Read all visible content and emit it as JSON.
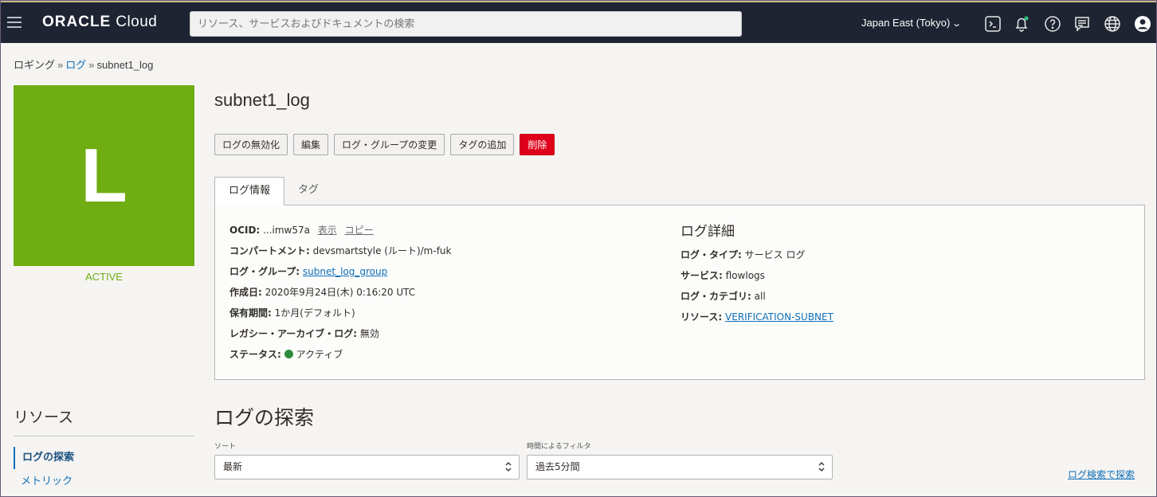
{
  "header": {
    "brand": "ORACLE",
    "product": "Cloud",
    "search_placeholder": "リソース、サービスおよびドキュメントの検索",
    "region": "Japan East (Tokyo)",
    "icons": [
      "menu-icon",
      "cloud-shell-icon",
      "bell-icon",
      "help-icon",
      "chat-icon",
      "globe-icon",
      "user-icon"
    ],
    "colors": {
      "bar": "#1e2432",
      "notification_dot": "#2ec27e"
    }
  },
  "breadcrumb": {
    "items": [
      "ロギング",
      "ログ",
      "subnet1_log"
    ],
    "separator": "»"
  },
  "resource": {
    "letter": "L",
    "status": "ACTIVE",
    "tile_color": "#6fad12"
  },
  "page": {
    "title": "subnet1_log"
  },
  "actions": {
    "disable": "ログの無効化",
    "edit": "編集",
    "change_group": "ログ・グループの変更",
    "add_tags": "タグの追加",
    "delete": "削除"
  },
  "tabs": [
    {
      "label": "ログ情報",
      "active": true
    },
    {
      "label": "タグ",
      "active": false
    }
  ],
  "log_info": {
    "ocid_label": "OCID:",
    "ocid_value": "...imw57a",
    "ocid_show": "表示",
    "ocid_copy": "コピー",
    "compartment_label": "コンパートメント:",
    "compartment_value": "devsmartstyle (ルート)/m-fuk",
    "group_label": "ログ・グループ:",
    "group_value": "subnet_log_group",
    "created_label": "作成日:",
    "created_value": "2020年9月24日(木) 0:16:20 UTC",
    "retention_label": "保有期間:",
    "retention_value": "1か月(デフォルト)",
    "legacy_label": "レガシー・アーカイブ・ログ:",
    "legacy_value": "無効",
    "status_label": "ステータス:",
    "status_value": "アクティブ"
  },
  "log_details": {
    "heading": "ログ詳細",
    "type_label": "ログ・タイプ:",
    "type_value": "サービス ログ",
    "service_label": "サービス:",
    "service_value": "flowlogs",
    "category_label": "ログ・カテゴリ:",
    "category_value": "all",
    "resource_label": "リソース:",
    "resource_value": "VERIFICATION-SUBNET"
  },
  "resources_nav": {
    "title": "リソース",
    "items": [
      {
        "label": "ログの探索",
        "active": true
      },
      {
        "label": "メトリック",
        "active": false
      }
    ]
  },
  "explore": {
    "title": "ログの探索",
    "sort_label": "ソート",
    "sort_value": "最新",
    "filter_label": "時間によるフィルタ",
    "filter_value": "過去5分間",
    "search_link": "ログ検索で探索"
  }
}
